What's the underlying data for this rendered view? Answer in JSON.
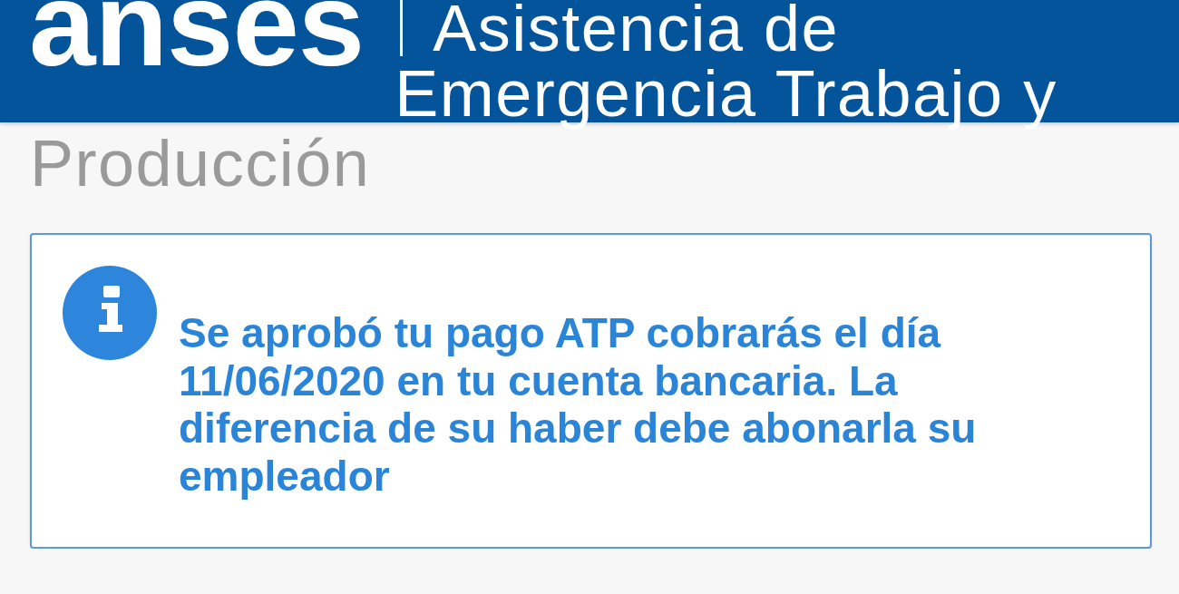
{
  "header": {
    "logo": "anses",
    "title_lines": [
      "Asistencia de",
      "Emergencia Trabajo y",
      "Producción"
    ]
  },
  "alert": {
    "kind": "info",
    "message": "Se aprobó tu pago ATP cobrarás el día 11/06/2020 en tu cuenta bancaria. La diferencia de su haber debe abonarla su empleador"
  }
}
